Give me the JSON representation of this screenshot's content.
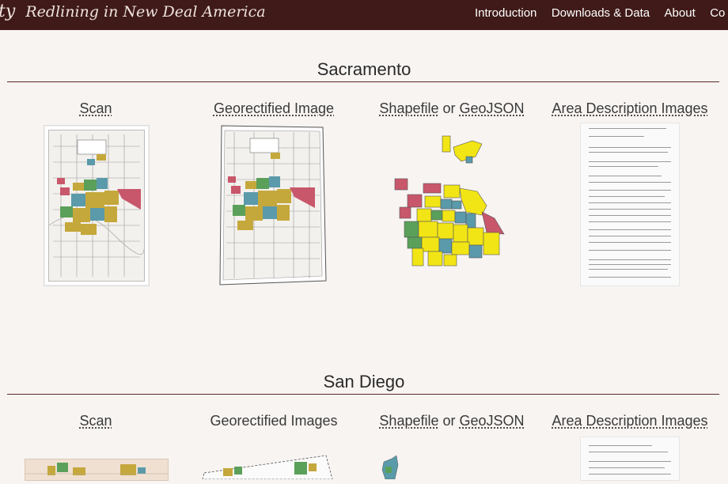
{
  "header": {
    "brand_partial": "ty",
    "subtitle": "Redlining in New Deal America",
    "nav": [
      "Introduction",
      "Downloads & Data",
      "About",
      "Co"
    ]
  },
  "sections": [
    {
      "city": "Sacramento",
      "scan_label": "Scan",
      "georect_label": "Georectified Image",
      "shapefile_label": "Shapefile",
      "or_label": "or",
      "geojson_label": "GeoJSON",
      "area_label": "Area Description Images"
    },
    {
      "city": "San Diego",
      "scan_label": "Scan",
      "georect_label": "Georectified Images",
      "shapefile_label": "Shapefile",
      "or_label": "or",
      "geojson_label": "GeoJSON",
      "area_label": "Area Description Images"
    }
  ],
  "colors": {
    "header_bg": "#3f1a18",
    "page_bg": "#f7f4f2",
    "rule": "#5a2a26",
    "grade_a": "#5aa05a",
    "grade_b": "#5a9aaa",
    "grade_c": "#f2e515",
    "grade_c_scan": "#c5a83c",
    "grade_d": "#c8576b"
  }
}
